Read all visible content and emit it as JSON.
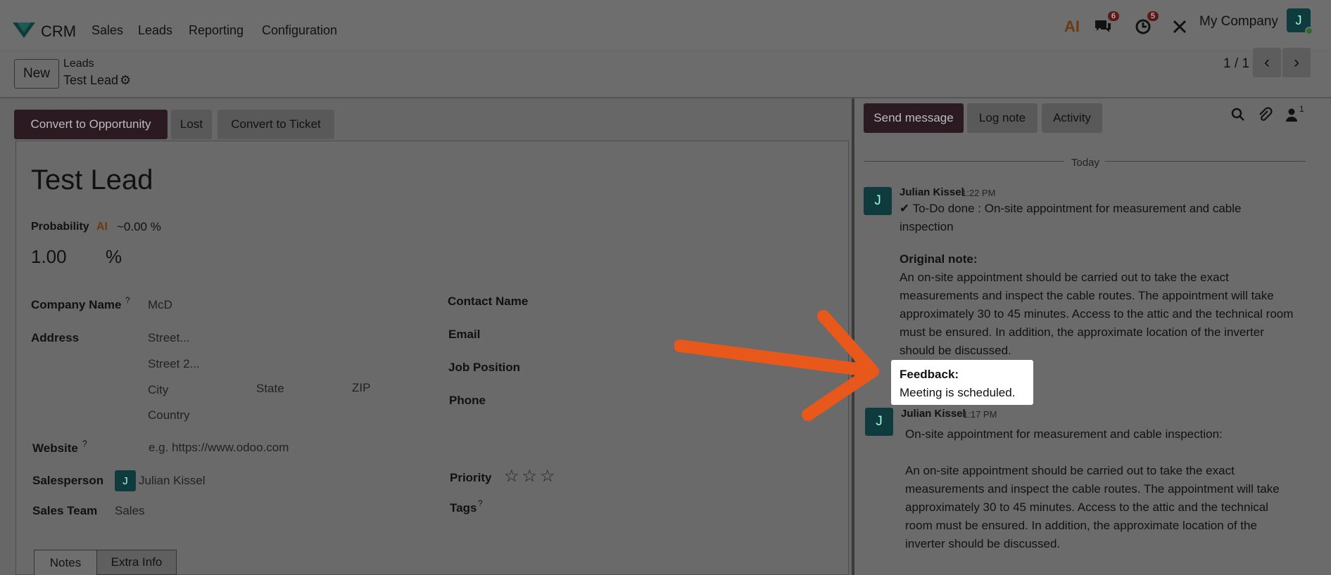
{
  "topbar": {
    "brand": "CRM",
    "menu": [
      "Sales",
      "Leads",
      "Reporting",
      "Configuration"
    ],
    "ai_label": "AI",
    "messages_count": "6",
    "activities_count": "5",
    "company": "My Company",
    "user_initial": "J"
  },
  "control": {
    "new_label": "New",
    "breadcrumb_parent": "Leads",
    "breadcrumb_current": "Test Lead",
    "pager": "1 / 1"
  },
  "actions": {
    "convert_opportunity": "Convert to Opportunity",
    "lost": "Lost",
    "convert_ticket": "Convert to Ticket"
  },
  "form": {
    "title": "Test Lead",
    "probability_label": "Probability",
    "ai_label": "AI",
    "ai_probability": "~0.00 %",
    "probability_value": "1.00",
    "percent": "%",
    "company_name_label": "Company Name",
    "company_name_value": "McD",
    "address_label": "Address",
    "street_ph": "Street...",
    "street2_ph": "Street 2...",
    "city_ph": "City",
    "state_ph": "State",
    "zip_ph": "ZIP",
    "country_ph": "Country",
    "website_label": "Website",
    "website_ph": "e.g. https://www.odoo.com",
    "salesperson_label": "Salesperson",
    "salesperson_initial": "J",
    "salesperson_value": "Julian Kissel",
    "sales_team_label": "Sales Team",
    "sales_team_value": "Sales",
    "contact_name_label": "Contact Name",
    "email_label": "Email",
    "job_position_label": "Job Position",
    "phone_label": "Phone",
    "priority_label": "Priority",
    "priority_stars": "☆☆☆",
    "tags_label": "Tags",
    "help_mark": "?",
    "tabs": [
      "Notes",
      "Extra Info"
    ]
  },
  "chatter": {
    "send_message": "Send message",
    "log_note": "Log note",
    "activity": "Activity",
    "followers_count": "1",
    "date_separator": "Today",
    "messages": [
      {
        "author": "Julian Kissel",
        "time": "1:22 PM",
        "initial": "J",
        "line1": "✔ To-Do done : On-site appointment for measurement and cable",
        "line2": "inspection",
        "original_note_label": "Original note:",
        "note_lines": [
          "An on-site appointment should be carried out to take the exact",
          "measurements and inspect the cable routes. The appointment will take",
          "approximately 30 to 45 minutes. Access to the attic and the technical room",
          "must be ensured. In addition, the approximate location of the inverter",
          "should be discussed."
        ],
        "feedback_label": "Feedback:",
        "feedback_text": "Meeting is scheduled."
      },
      {
        "author": "Julian Kissel",
        "time": "1:17 PM",
        "initial": "J",
        "line1": "On-site appointment for measurement and cable inspection:",
        "note_lines": [
          "An on-site appointment should be carried out to take the exact",
          "measurements and inspect the cable routes. The appointment will take",
          "approximately 30 to 45 minutes. Access to the attic and the technical",
          "room must be ensured. In addition, the approximate location of the",
          "inverter should be discussed."
        ]
      }
    ]
  },
  "colors": {
    "arrow": "#e8581a",
    "primary_button": "#2c1a22",
    "avatar": "#0f3a3e"
  }
}
